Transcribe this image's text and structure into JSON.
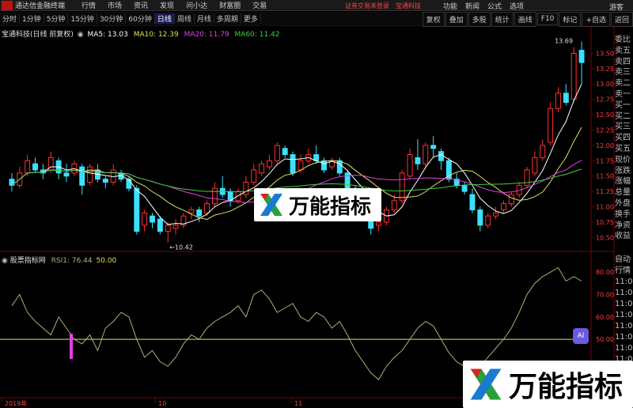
{
  "app": {
    "title": "通达信金融终端",
    "menus": [
      "行情",
      "市场",
      "资讯",
      "发现",
      "问小达",
      "财富圈",
      "交易"
    ],
    "notice": "证券交易未登录",
    "account": "宝通科技",
    "right_menus": [
      "功能",
      "新闻",
      "公式",
      "选项"
    ],
    "guest": "游客"
  },
  "toolbar": {
    "periods": [
      "分时",
      "1分钟",
      "5分钟",
      "15分钟",
      "30分钟",
      "60分钟",
      "日线",
      "周线",
      "月线",
      "多周期",
      "更多"
    ],
    "active_period": "日线",
    "right_buttons": [
      "复权",
      "叠加",
      "多股",
      "统计",
      "画线",
      "F10",
      "标记",
      "+自选",
      "返回"
    ]
  },
  "main_chart": {
    "stock_name": "宝通科技(日线 前复权)",
    "ma5": "MA5: 13.03",
    "ma10": "MA10: 12.39",
    "ma20": "MA20: 11.79",
    "ma60": "MA60: 11.42",
    "high_label": "13.69",
    "low_label": "←10.42",
    "price_ticks": [
      "13.50",
      "13.25",
      "13.00",
      "12.75",
      "12.50",
      "12.25",
      "12.00",
      "11.75",
      "11.50",
      "11.25",
      "11.00",
      "10.75",
      "10.50"
    ]
  },
  "rsi_chart": {
    "name": "股票指标网",
    "rsi1": "RSI1: 76.44",
    "level": "50.00",
    "ticks": [
      "80.00",
      "70.00",
      "60.00",
      "50.00"
    ]
  },
  "x_axis": {
    "labels": [
      "2019年",
      "10",
      "11"
    ]
  },
  "info_column": [
    "委比",
    "卖五",
    "卖四",
    "卖三",
    "卖二",
    "卖一",
    "买一",
    "买二",
    "买三",
    "买四",
    "买五",
    "现价",
    "涨跌",
    "涨幅",
    "总量",
    "外盘",
    "换手",
    "净资",
    "收益"
  ],
  "info_column2": [
    "自动",
    "行情",
    "11:0",
    "11:0",
    "11:0",
    "11:0",
    "11:0",
    "11:0",
    "11:0",
    "11:0",
    "11:0",
    "11:0"
  ],
  "watermark": {
    "text": "万能指标"
  },
  "ai_badge": "AI",
  "colors": {
    "up": "#ff3030",
    "down": "#3be0ff",
    "ma5": "#ffffff",
    "ma10": "#e0e060",
    "ma20": "#e040e0",
    "ma60": "#40d040",
    "rsi": "#b0b070",
    "grid_red": "#7a0000"
  },
  "chart_data": {
    "type": "candlestick",
    "price_range": [
      10.35,
      13.75
    ],
    "candles": [
      {
        "o": 11.45,
        "c": 11.35,
        "h": 11.55,
        "l": 11.25
      },
      {
        "o": 11.35,
        "c": 11.55,
        "h": 11.65,
        "l": 11.3
      },
      {
        "o": 11.55,
        "c": 11.75,
        "h": 11.85,
        "l": 11.5
      },
      {
        "o": 11.7,
        "c": 11.6,
        "h": 11.8,
        "l": 11.55
      },
      {
        "o": 11.6,
        "c": 11.55,
        "h": 11.7,
        "l": 11.45
      },
      {
        "o": 11.6,
        "c": 11.8,
        "h": 11.9,
        "l": 11.55
      },
      {
        "o": 11.75,
        "c": 11.55,
        "h": 11.8,
        "l": 11.45
      },
      {
        "o": 11.55,
        "c": 11.5,
        "h": 11.7,
        "l": 11.4
      },
      {
        "o": 11.55,
        "c": 11.7,
        "h": 11.75,
        "l": 11.5
      },
      {
        "o": 11.65,
        "c": 11.35,
        "h": 11.7,
        "l": 11.2
      },
      {
        "o": 11.4,
        "c": 11.65,
        "h": 11.7,
        "l": 11.35
      },
      {
        "o": 11.6,
        "c": 11.45,
        "h": 11.7,
        "l": 11.4
      },
      {
        "o": 11.45,
        "c": 11.4,
        "h": 11.5,
        "l": 11.3
      },
      {
        "o": 11.4,
        "c": 11.6,
        "h": 11.7,
        "l": 11.35
      },
      {
        "o": 11.55,
        "c": 11.45,
        "h": 11.6,
        "l": 11.4
      },
      {
        "o": 11.45,
        "c": 11.3,
        "h": 11.5,
        "l": 11.25
      },
      {
        "o": 11.3,
        "c": 10.6,
        "h": 11.35,
        "l": 10.55
      },
      {
        "o": 10.7,
        "c": 10.9,
        "h": 10.95,
        "l": 10.6
      },
      {
        "o": 10.85,
        "c": 10.75,
        "h": 10.9,
        "l": 10.65
      },
      {
        "o": 10.8,
        "c": 10.6,
        "h": 10.85,
        "l": 10.55
      },
      {
        "o": 10.6,
        "c": 10.7,
        "h": 10.75,
        "l": 10.42
      },
      {
        "o": 10.65,
        "c": 10.7,
        "h": 10.8,
        "l": 10.55
      },
      {
        "o": 10.7,
        "c": 10.85,
        "h": 10.9,
        "l": 10.65
      },
      {
        "o": 10.9,
        "c": 10.95,
        "h": 11.0,
        "l": 10.8
      },
      {
        "o": 10.95,
        "c": 10.85,
        "h": 11.0,
        "l": 10.75
      },
      {
        "o": 10.9,
        "c": 11.05,
        "h": 11.1,
        "l": 10.85
      },
      {
        "o": 11.05,
        "c": 11.3,
        "h": 11.4,
        "l": 11.0
      },
      {
        "o": 11.3,
        "c": 11.2,
        "h": 11.5,
        "l": 11.15
      },
      {
        "o": 11.25,
        "c": 11.1,
        "h": 11.3,
        "l": 11.0
      },
      {
        "o": 11.1,
        "c": 11.25,
        "h": 11.3,
        "l": 11.05
      },
      {
        "o": 11.2,
        "c": 11.4,
        "h": 11.5,
        "l": 11.15
      },
      {
        "o": 11.4,
        "c": 11.6,
        "h": 11.7,
        "l": 11.35
      },
      {
        "o": 11.55,
        "c": 11.7,
        "h": 11.75,
        "l": 11.5
      },
      {
        "o": 11.65,
        "c": 11.75,
        "h": 11.85,
        "l": 11.6
      },
      {
        "o": 11.75,
        "c": 12.0,
        "h": 12.05,
        "l": 11.7
      },
      {
        "o": 11.95,
        "c": 11.85,
        "h": 12.0,
        "l": 11.8
      },
      {
        "o": 11.85,
        "c": 11.55,
        "h": 11.9,
        "l": 11.5
      },
      {
        "o": 11.6,
        "c": 11.75,
        "h": 11.85,
        "l": 11.55
      },
      {
        "o": 11.75,
        "c": 11.85,
        "h": 11.95,
        "l": 11.7
      },
      {
        "o": 11.85,
        "c": 11.75,
        "h": 12.0,
        "l": 11.7
      },
      {
        "o": 11.75,
        "c": 11.6,
        "h": 11.8,
        "l": 11.55
      },
      {
        "o": 11.65,
        "c": 11.75,
        "h": 11.8,
        "l": 11.6
      },
      {
        "o": 11.75,
        "c": 11.55,
        "h": 11.8,
        "l": 11.5
      },
      {
        "o": 11.55,
        "c": 11.3,
        "h": 11.6,
        "l": 11.25
      },
      {
        "o": 11.3,
        "c": 11.0,
        "h": 11.35,
        "l": 10.95
      },
      {
        "o": 11.0,
        "c": 10.9,
        "h": 11.1,
        "l": 10.85
      },
      {
        "o": 10.9,
        "c": 10.65,
        "h": 10.95,
        "l": 10.55
      },
      {
        "o": 10.7,
        "c": 10.75,
        "h": 10.8,
        "l": 10.6
      },
      {
        "o": 10.75,
        "c": 10.95,
        "h": 11.0,
        "l": 10.7
      },
      {
        "o": 10.95,
        "c": 11.1,
        "h": 11.2,
        "l": 10.9
      },
      {
        "o": 11.1,
        "c": 11.55,
        "h": 11.6,
        "l": 11.05
      },
      {
        "o": 11.5,
        "c": 11.85,
        "h": 11.95,
        "l": 11.45
      },
      {
        "o": 11.8,
        "c": 11.7,
        "h": 12.1,
        "l": 11.6
      },
      {
        "o": 11.7,
        "c": 12.0,
        "h": 12.05,
        "l": 11.65
      },
      {
        "o": 12.0,
        "c": 11.95,
        "h": 12.15,
        "l": 11.8
      },
      {
        "o": 11.9,
        "c": 11.75,
        "h": 11.95,
        "l": 11.6
      },
      {
        "o": 11.75,
        "c": 11.45,
        "h": 11.8,
        "l": 11.4
      },
      {
        "o": 11.45,
        "c": 11.35,
        "h": 11.55,
        "l": 11.3
      },
      {
        "o": 11.35,
        "c": 11.25,
        "h": 11.4,
        "l": 11.2
      },
      {
        "o": 11.2,
        "c": 10.95,
        "h": 11.3,
        "l": 10.9
      },
      {
        "o": 10.95,
        "c": 10.7,
        "h": 11.0,
        "l": 10.6
      },
      {
        "o": 10.7,
        "c": 10.85,
        "h": 10.9,
        "l": 10.65
      },
      {
        "o": 10.85,
        "c": 10.9,
        "h": 11.0,
        "l": 10.8
      },
      {
        "o": 10.95,
        "c": 11.05,
        "h": 11.1,
        "l": 10.9
      },
      {
        "o": 11.05,
        "c": 11.2,
        "h": 11.25,
        "l": 11.0
      },
      {
        "o": 11.2,
        "c": 11.35,
        "h": 11.4,
        "l": 11.15
      },
      {
        "o": 11.35,
        "c": 11.6,
        "h": 11.65,
        "l": 11.3
      },
      {
        "o": 11.55,
        "c": 11.8,
        "h": 11.9,
        "l": 11.5
      },
      {
        "o": 11.8,
        "c": 12.0,
        "h": 12.1,
        "l": 11.75
      },
      {
        "o": 12.05,
        "c": 12.6,
        "h": 12.7,
        "l": 12.0
      },
      {
        "o": 12.6,
        "c": 12.85,
        "h": 12.95,
        "l": 12.55
      },
      {
        "o": 12.85,
        "c": 12.7,
        "h": 13.0,
        "l": 12.65
      },
      {
        "o": 12.75,
        "c": 13.5,
        "h": 13.6,
        "l": 12.7
      },
      {
        "o": 13.55,
        "c": 13.35,
        "h": 13.69,
        "l": 13.0
      }
    ],
    "rsi": [
      65,
      70,
      62,
      58,
      55,
      52,
      60,
      55,
      50,
      48,
      52,
      45,
      55,
      58,
      62,
      60,
      50,
      42,
      45,
      40,
      38,
      42,
      48,
      52,
      50,
      55,
      58,
      60,
      62,
      65,
      60,
      70,
      72,
      68,
      62,
      64,
      66,
      60,
      58,
      62,
      60,
      55,
      58,
      52,
      45,
      40,
      35,
      32,
      38,
      42,
      45,
      50,
      55,
      58,
      56,
      50,
      44,
      40,
      38,
      35,
      38,
      42,
      46,
      50,
      55,
      62,
      70,
      75,
      78,
      80,
      82,
      76,
      78,
      76
    ]
  }
}
